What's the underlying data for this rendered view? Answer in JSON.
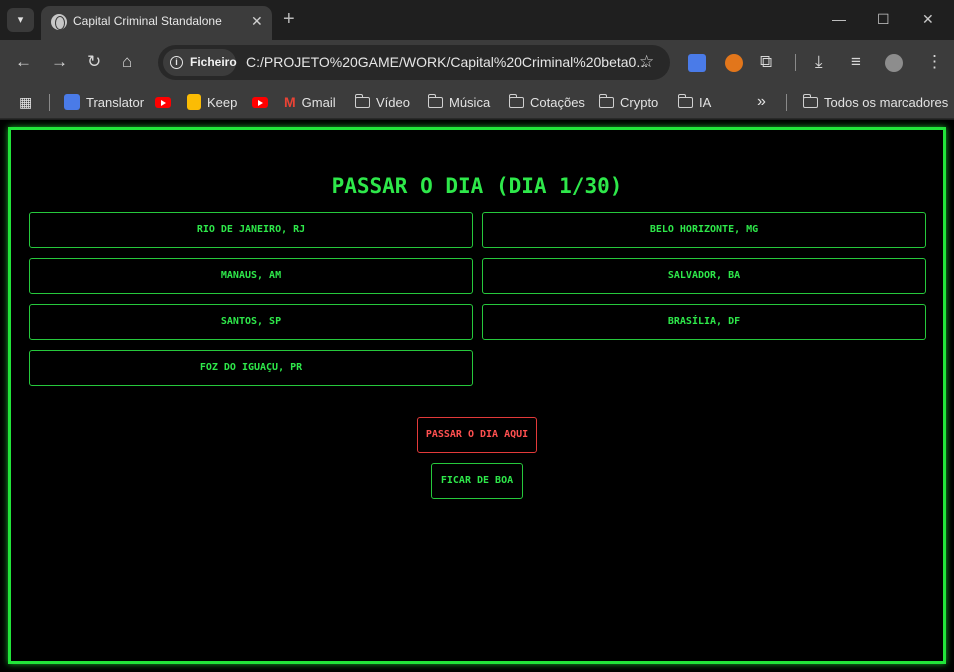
{
  "browser": {
    "tab_title": "Capital Criminal Standalone",
    "tab_search_icon": "chevron-down-icon",
    "new_tab_glyph": "+",
    "close_glyph": "✕",
    "address": {
      "chip_label": "Ficheiro",
      "url": "C:/PROJETO%20GAME/WORK/Capital%20Criminal%20beta0..."
    },
    "bookmarks": [
      {
        "label": "Translator",
        "icon": "google-translate-icon"
      },
      {
        "label": "",
        "icon": "youtube-icon"
      },
      {
        "label": "Keep",
        "icon": "keep-icon"
      },
      {
        "label": "",
        "icon": "youtube-icon"
      },
      {
        "label": "Gmail",
        "icon": "gmail-icon"
      },
      {
        "label": "Vídeo",
        "icon": "folder-icon"
      },
      {
        "label": "Música",
        "icon": "folder-icon"
      },
      {
        "label": "Cotações",
        "icon": "folder-icon"
      },
      {
        "label": "Crypto",
        "icon": "folder-icon"
      },
      {
        "label": "IA",
        "icon": "folder-icon"
      }
    ],
    "overflow_glyph": "»",
    "all_bookmarks": "Todos os marcadores"
  },
  "game": {
    "title": "PASSAR O DIA (DIA 1/30)",
    "cities": [
      "RIO DE JANEIRO, RJ",
      "BELO HORIZONTE, MG",
      "MANAUS, AM",
      "SALVADOR, BA",
      "SANTOS, SP",
      "BRASÍLIA, DF",
      "FOZ DO IGUAÇU, PR"
    ],
    "pass_here_label": "PASSAR O DIA AQUI",
    "stay_label": "FICAR DE BOA"
  },
  "colors": {
    "accent_green": "#2ee84a",
    "danger_red": "#ff5050",
    "background": "#000000"
  }
}
